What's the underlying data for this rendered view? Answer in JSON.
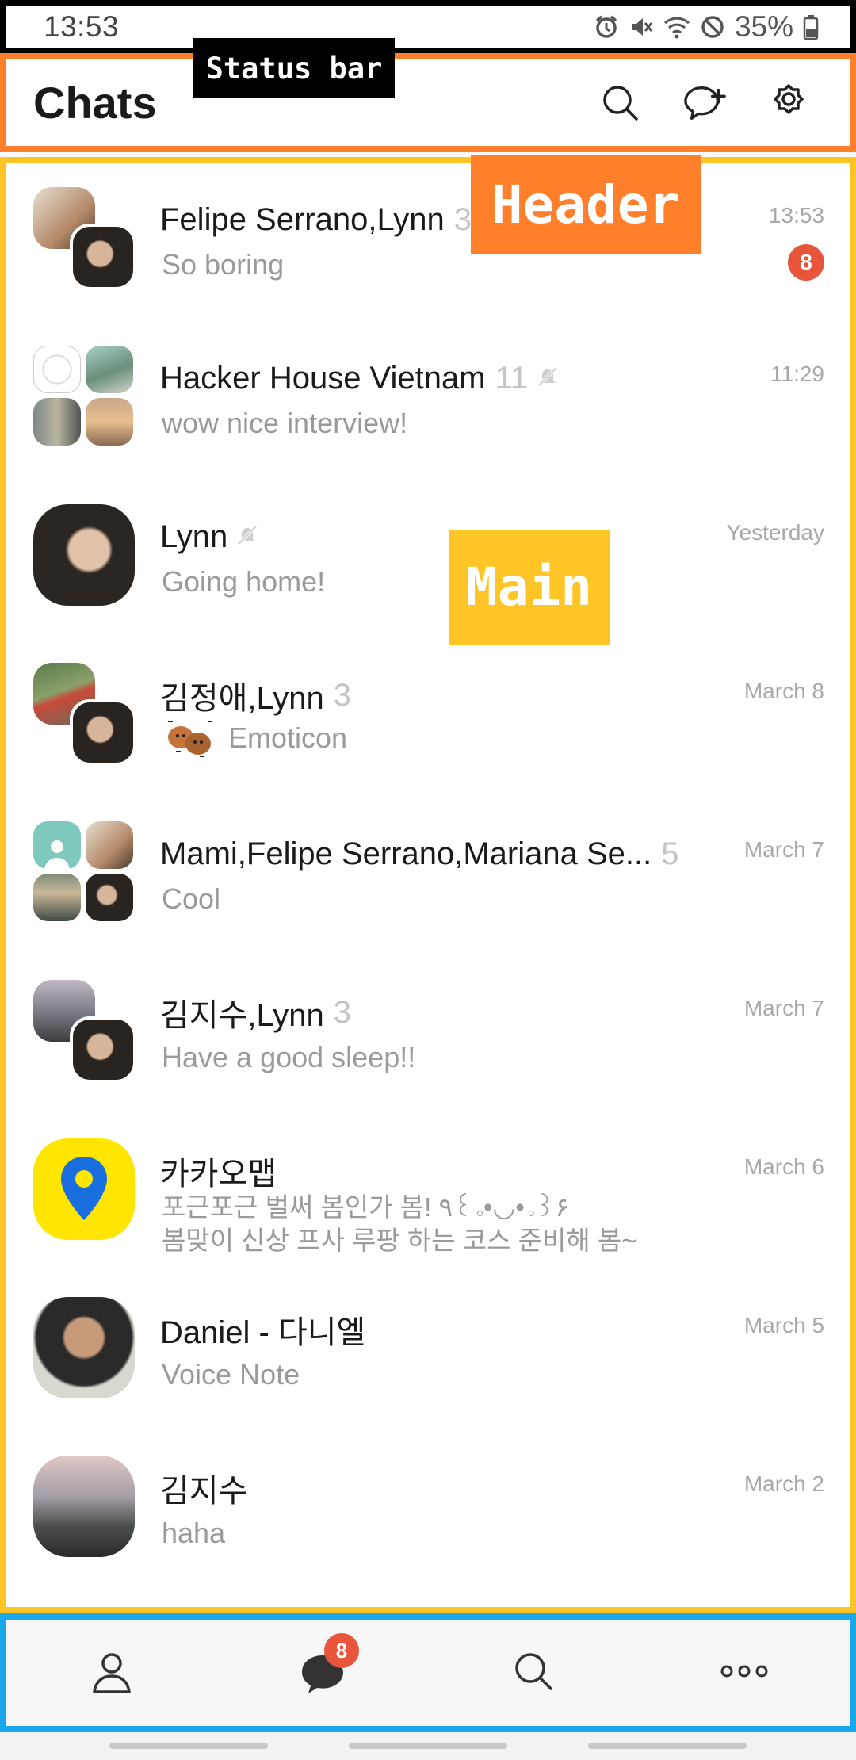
{
  "status_bar": {
    "time": "13:53",
    "battery": "35%",
    "icons": [
      "alarm-icon",
      "mute-icon",
      "wifi-icon",
      "dnd-icon",
      "battery-icon"
    ]
  },
  "annotations": {
    "status_bar": "Status bar",
    "header": "Header",
    "main": "Main"
  },
  "header": {
    "title": "Chats",
    "actions": [
      "search-icon",
      "new-chat-icon",
      "settings-icon"
    ]
  },
  "chats": [
    {
      "name": "Felipe Serrano,Lynn",
      "count": "3",
      "preview": "So boring",
      "time": "13:53",
      "unread": "8"
    },
    {
      "name": "Hacker House Vietnam",
      "count": "11",
      "muted": true,
      "preview": "wow nice interview!",
      "time": "11:29"
    },
    {
      "name": "Lynn",
      "muted": true,
      "preview": "Going home!",
      "time": "Yesterday"
    },
    {
      "name": "김정애,Lynn",
      "count": "3",
      "preview": "Emoticon",
      "time": "March 8"
    },
    {
      "name": "Mami,Felipe Serrano,Mariana Se...",
      "count": "5",
      "preview": "Cool",
      "time": "March 7"
    },
    {
      "name": "김지수,Lynn",
      "count": "3",
      "preview": "Have a good sleep!!",
      "time": "March 7"
    },
    {
      "name": "카카오맵",
      "preview": "포근포근 벌써 봄인가 봄! ٩꒰｡•◡•｡꒱۶",
      "preview2": "봄맞이 신상 프사 루팡 하는 코스 준비해 봄~",
      "time": "March 6"
    },
    {
      "name": "Daniel - 다니엘",
      "preview": "Voice Note",
      "time": "March 5"
    },
    {
      "name": "김지수",
      "preview": "haha",
      "time": "March 2"
    }
  ],
  "bottom_nav": {
    "items": [
      "friends-icon",
      "chats-icon",
      "search-icon",
      "more-icon"
    ],
    "chats_badge": "8"
  },
  "colors": {
    "accent_badge": "#e8553b",
    "status_border": "#000000",
    "header_border": "#ff7f2a",
    "main_border": "#ffc425",
    "nav_border": "#1aa7ec"
  }
}
